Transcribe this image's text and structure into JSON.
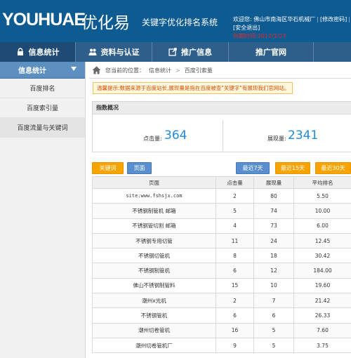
{
  "header": {
    "logo_en": "YOUHUAE",
    "logo_cn": "优化易",
    "subtitle": "关键字优化排名系统",
    "welcome": "欢迎您: 佛山市南海区华石机械厂",
    "change_password": "[修改密码]",
    "logout": "[安全退出]",
    "expire": "到期时间:2017/1/27"
  },
  "nav": {
    "items": [
      {
        "label": "信息统计",
        "icon": "lock-icon"
      },
      {
        "label": "资料与认证",
        "icon": "users-icon"
      },
      {
        "label": "推广信息",
        "icon": "share-icon"
      },
      {
        "label": "推广官网",
        "icon": ""
      }
    ]
  },
  "sidebar": {
    "title": "信息统计",
    "items": [
      {
        "label": "百度排名"
      },
      {
        "label": "百度索引量"
      },
      {
        "label": "百度流量与关键词"
      }
    ]
  },
  "breadcrumb": {
    "prefix": "您当前的位置：",
    "level1": "信息统计",
    "sep": ">",
    "level2": "百度引索量"
  },
  "tip": {
    "label": "温馨提示:",
    "text": "数据来源于百度站长,展现量是指在百度被查\"关键字\"有展现我们官网站。"
  },
  "overview": {
    "title": "指数概况",
    "clicks_label": "点击量:",
    "clicks_value": "364",
    "impressions_label": "展现量:",
    "impressions_value": "2341"
  },
  "buttons": {
    "keyword": "关键词",
    "page": "页面",
    "last7": "最近7天",
    "last15": "最近15天",
    "last30": "最近30天"
  },
  "table": {
    "headers": [
      "页面",
      "点击量",
      "展现量",
      "平均排名"
    ],
    "rows": [
      [
        "site:www.fshsjx.com",
        "2",
        "80",
        "5.50"
      ],
      [
        "不锈钢制管机 邮箱",
        "5",
        "74",
        "10.00"
      ],
      [
        "不锈钢管切割 邮箱",
        "4",
        "73",
        "6.00"
      ],
      [
        "不锈钢专用切管",
        "11",
        "24",
        "12.45"
      ],
      [
        "不锈钢切管机",
        "8",
        "18",
        "30.42"
      ],
      [
        "不锈钢制管机",
        "6",
        "12",
        "184.00"
      ],
      [
        "佛山不锈钢制管料",
        "15",
        "10",
        "19.60"
      ],
      [
        "潮州x光机",
        "2",
        "7",
        "21.42"
      ],
      [
        "不锈钢管机",
        "6",
        "6",
        "26.33"
      ],
      [
        "潮州切卷管机",
        "16",
        "5",
        "7.60"
      ],
      [
        "潮州切卷管机厂",
        "9",
        "5",
        "3.75"
      ]
    ]
  },
  "colors": {
    "header_bg": "#0e5b92",
    "nav_bg": "#2e5f8a",
    "accent_blue": "#1f8ad6",
    "orange": "#f7a400",
    "warning_red": "#e02a2a"
  }
}
